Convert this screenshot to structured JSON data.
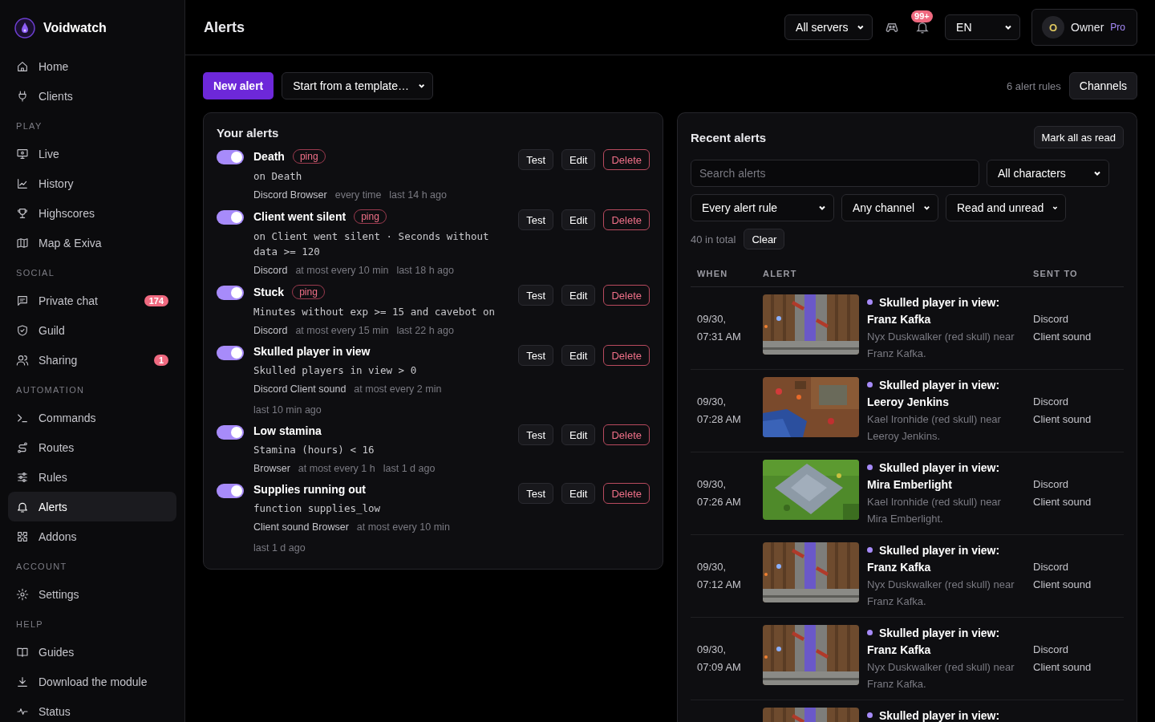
{
  "app": {
    "name": "Voidwatch"
  },
  "sidebar": {
    "sections": [
      {
        "items": [
          {
            "label": "Home",
            "selected": false
          },
          {
            "label": "Clients",
            "selected": false
          }
        ]
      },
      {
        "title": "PLAY",
        "items": [
          {
            "label": "Live",
            "selected": false
          },
          {
            "label": "History",
            "selected": false
          },
          {
            "label": "Highscores",
            "selected": false
          },
          {
            "label": "Map & Exiva",
            "selected": false
          }
        ]
      },
      {
        "title": "SOCIAL",
        "items": [
          {
            "label": "Private chat",
            "selected": false,
            "badge": "174"
          },
          {
            "label": "Guild",
            "selected": false
          },
          {
            "label": "Sharing",
            "selected": false,
            "badge": "1"
          }
        ]
      },
      {
        "title": "AUTOMATION",
        "items": [
          {
            "label": "Commands",
            "selected": false
          },
          {
            "label": "Routes",
            "selected": false
          },
          {
            "label": "Rules",
            "selected": false
          },
          {
            "label": "Alerts",
            "selected": true
          },
          {
            "label": "Addons",
            "selected": false
          }
        ]
      },
      {
        "title": "ACCOUNT",
        "items": [
          {
            "label": "Settings",
            "selected": false
          }
        ]
      },
      {
        "title": "HELP",
        "items": [
          {
            "label": "Guides",
            "selected": false
          },
          {
            "label": "Download the module",
            "selected": false
          },
          {
            "label": "Status",
            "selected": false
          }
        ]
      }
    ]
  },
  "header": {
    "title": "Alerts",
    "server_select": "All servers",
    "notifications_badge": "99+",
    "language_select": "EN",
    "user": {
      "initial": "O",
      "name": "Owner",
      "plan": "Pro"
    }
  },
  "toolbar": {
    "new_button": "New alert",
    "template_select": "Start from a template…",
    "rule_count": "6 alert rules",
    "channels_button": "Channels"
  },
  "your_alerts": {
    "title": "Your alerts",
    "rules": [
      {
        "name": "Death",
        "on": true,
        "tag": "ping",
        "actions": [
          "Test",
          "Edit",
          "Delete"
        ],
        "condition": "on Death",
        "channels": "Discord Browser",
        "frequency": "every time",
        "last": "last 14 h ago"
      },
      {
        "name": "Client went silent",
        "on": true,
        "tag": "ping",
        "actions": [
          "Test",
          "Edit",
          "Delete"
        ],
        "condition": "on Client went silent · Seconds without data >= 120",
        "channels": "Discord",
        "frequency": "at most every 10 min",
        "last": "last 18 h ago"
      },
      {
        "name": "Stuck",
        "on": true,
        "tag": "ping",
        "actions": [
          "Test",
          "Edit",
          "Delete"
        ],
        "condition": "Minutes without exp >= 15 and cavebot on",
        "channels": "Discord",
        "frequency": "at most every 15 min",
        "last": "last 22 h ago"
      },
      {
        "name": "Skulled player in view",
        "on": true,
        "actions": [
          "Test",
          "Edit",
          "Delete"
        ],
        "condition": "Skulled players in view > 0",
        "channels": "Discord Client sound",
        "frequency": "at most every 2 min",
        "last": "last 10 min ago"
      },
      {
        "name": "Low stamina",
        "on": true,
        "actions": [
          "Test",
          "Edit",
          "Delete"
        ],
        "condition": "Stamina (hours) < 16",
        "channels": "Browser",
        "frequency": "at most every 1 h",
        "last": "last 1 d ago"
      },
      {
        "name": "Supplies running out",
        "on": true,
        "actions": [
          "Test",
          "Edit",
          "Delete"
        ],
        "condition": "function supplies_low",
        "channels": "Client sound Browser",
        "frequency": "at most every 10 min",
        "last": "last 1 d ago"
      }
    ]
  },
  "recent_alerts": {
    "title": "Recent alerts",
    "mark_all_button": "Mark all as read",
    "search": {
      "placeholder": "Search alerts"
    },
    "filters": [
      "All characters",
      "Every alert rule",
      "Any channel",
      "Read and unread"
    ],
    "total": "40 in total",
    "clear_button": "Clear",
    "table": {
      "columns": [
        "WHEN",
        "ALERT",
        "SENT TO"
      ],
      "rows": [
        {
          "when": "09/30, 07:31 AM",
          "kind": "picture",
          "unread": true,
          "title": "Skulled player in view: Franz Kafka",
          "description": "Nyx Duskwalker (red skull) near Franz Kafka.",
          "sent_to": [
            "Discord",
            "Client sound"
          ]
        },
        {
          "when": "09/30, 07:28 AM",
          "kind": "picture",
          "unread": true,
          "title": "Skulled player in view: Leeroy Jenkins",
          "description": "Kael Ironhide (red skull) near Leeroy Jenkins.",
          "sent_to": [
            "Discord",
            "Client sound"
          ]
        },
        {
          "when": "09/30, 07:26 AM",
          "kind": "picture",
          "unread": true,
          "title": "Skulled player in view: Mira Emberlight",
          "description": "Kael Ironhide (red skull) near Mira Emberlight.",
          "sent_to": [
            "Discord",
            "Client sound"
          ]
        },
        {
          "when": "09/30, 07:12 AM",
          "kind": "picture",
          "unread": true,
          "title": "Skulled player in view: Franz Kafka",
          "description": "Nyx Duskwalker (red skull) near Franz Kafka.",
          "sent_to": [
            "Discord",
            "Client sound"
          ]
        },
        {
          "when": "09/30, 07:09 AM",
          "kind": "picture",
          "unread": true,
          "title": "Skulled player in view: Franz Kafka",
          "description": "Nyx Duskwalker (red skull) near Franz Kafka.",
          "sent_to": [
            "Discord",
            "Client sound"
          ]
        },
        {
          "kind": "picture",
          "unread": true,
          "title": "Skulled player in view:"
        }
      ]
    }
  }
}
